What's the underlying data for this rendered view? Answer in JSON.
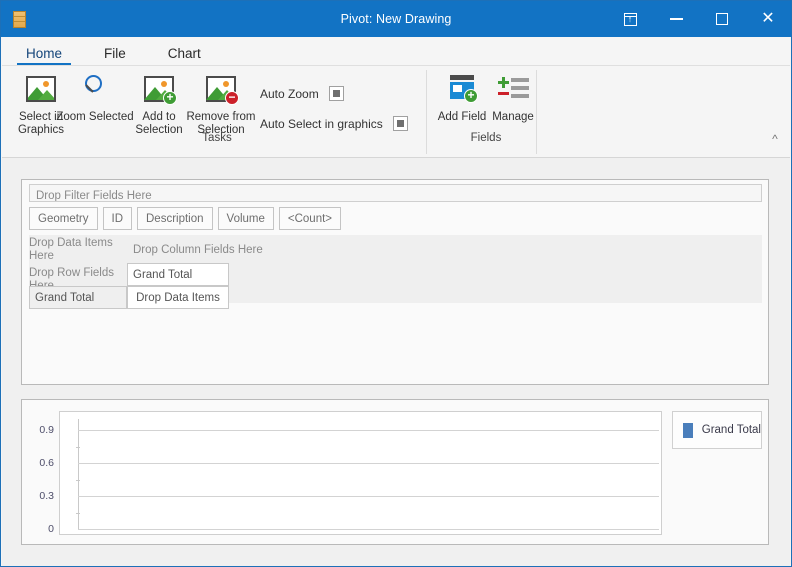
{
  "window": {
    "title": "Pivot: New Drawing",
    "app_icon": "database-icon",
    "controls": {
      "dock": "dock-icon",
      "minimize": "minimize-icon",
      "maximize": "maximize-icon",
      "close": "close-icon"
    }
  },
  "ribbon": {
    "tabs": [
      {
        "label": "Home",
        "active": true
      },
      {
        "label": "File",
        "active": false
      },
      {
        "label": "Chart",
        "active": false
      }
    ],
    "groups": [
      {
        "name": "Tasks",
        "label": "Tasks",
        "buttons": [
          {
            "label": "Select in\nGraphics",
            "line1": "Select in",
            "line2": "Graphics",
            "icon": "image-select-icon"
          },
          {
            "label": "Zoom Selected",
            "line1": "Zoom Selected",
            "line2": "",
            "icon": "magnifier-icon"
          },
          {
            "label": "Add to\nSelection",
            "line1": "Add to",
            "line2": "Selection",
            "icon": "image-add-icon"
          },
          {
            "label": "Remove from\nSelection",
            "line1": "Remove from",
            "line2": "Selection",
            "icon": "image-remove-icon"
          }
        ],
        "checks": [
          {
            "label": "Auto Zoom",
            "state": "indeterminate"
          },
          {
            "label": "Auto Select in graphics",
            "state": "indeterminate"
          }
        ]
      },
      {
        "name": "Fields",
        "label": "Fields",
        "buttons": [
          {
            "label": "Add Field",
            "line1": "Add Field",
            "line2": "",
            "icon": "add-field-icon"
          },
          {
            "label": "Manage",
            "line1": "Manage",
            "line2": "",
            "icon": "manage-fields-icon"
          }
        ]
      }
    ],
    "collapse_icon": "chevron-up-icon"
  },
  "pivot": {
    "filter_drop_label": "Drop Filter Fields Here",
    "field_chips": [
      {
        "label": "Geometry"
      },
      {
        "label": "ID"
      },
      {
        "label": "Description"
      },
      {
        "label": "Volume"
      },
      {
        "label": "<Count>"
      }
    ],
    "drop_data_items_here": "Drop Data Items Here",
    "drop_column_fields_here": "Drop Column Fields Here",
    "drop_row_fields_here": "Drop Row Fields Here",
    "column_grand_total": "Grand Total",
    "row_grand_total": "Grand Total",
    "drop_data_items": "Drop Data Items"
  },
  "chart_data": {
    "type": "bar",
    "title": "",
    "xlabel": "",
    "ylabel": "",
    "categories": [],
    "series": [
      {
        "name": "Grand Total",
        "values": [],
        "color": "#4a7ebb"
      }
    ],
    "ylim": [
      0,
      1.0
    ],
    "yticks": [
      "0.9",
      "0.6",
      "0.3",
      "0"
    ],
    "ytick_values": [
      0.9,
      0.6,
      0.3,
      0
    ],
    "grid": true,
    "legend_position": "right",
    "legend": [
      {
        "label": "Grand Total",
        "color": "#4a7ebb"
      }
    ]
  },
  "colors": {
    "titlebar": "#1273c4",
    "tab_accent": "#1273c4",
    "series_blue": "#4a7ebb",
    "client_background": "#f0f0f0"
  }
}
